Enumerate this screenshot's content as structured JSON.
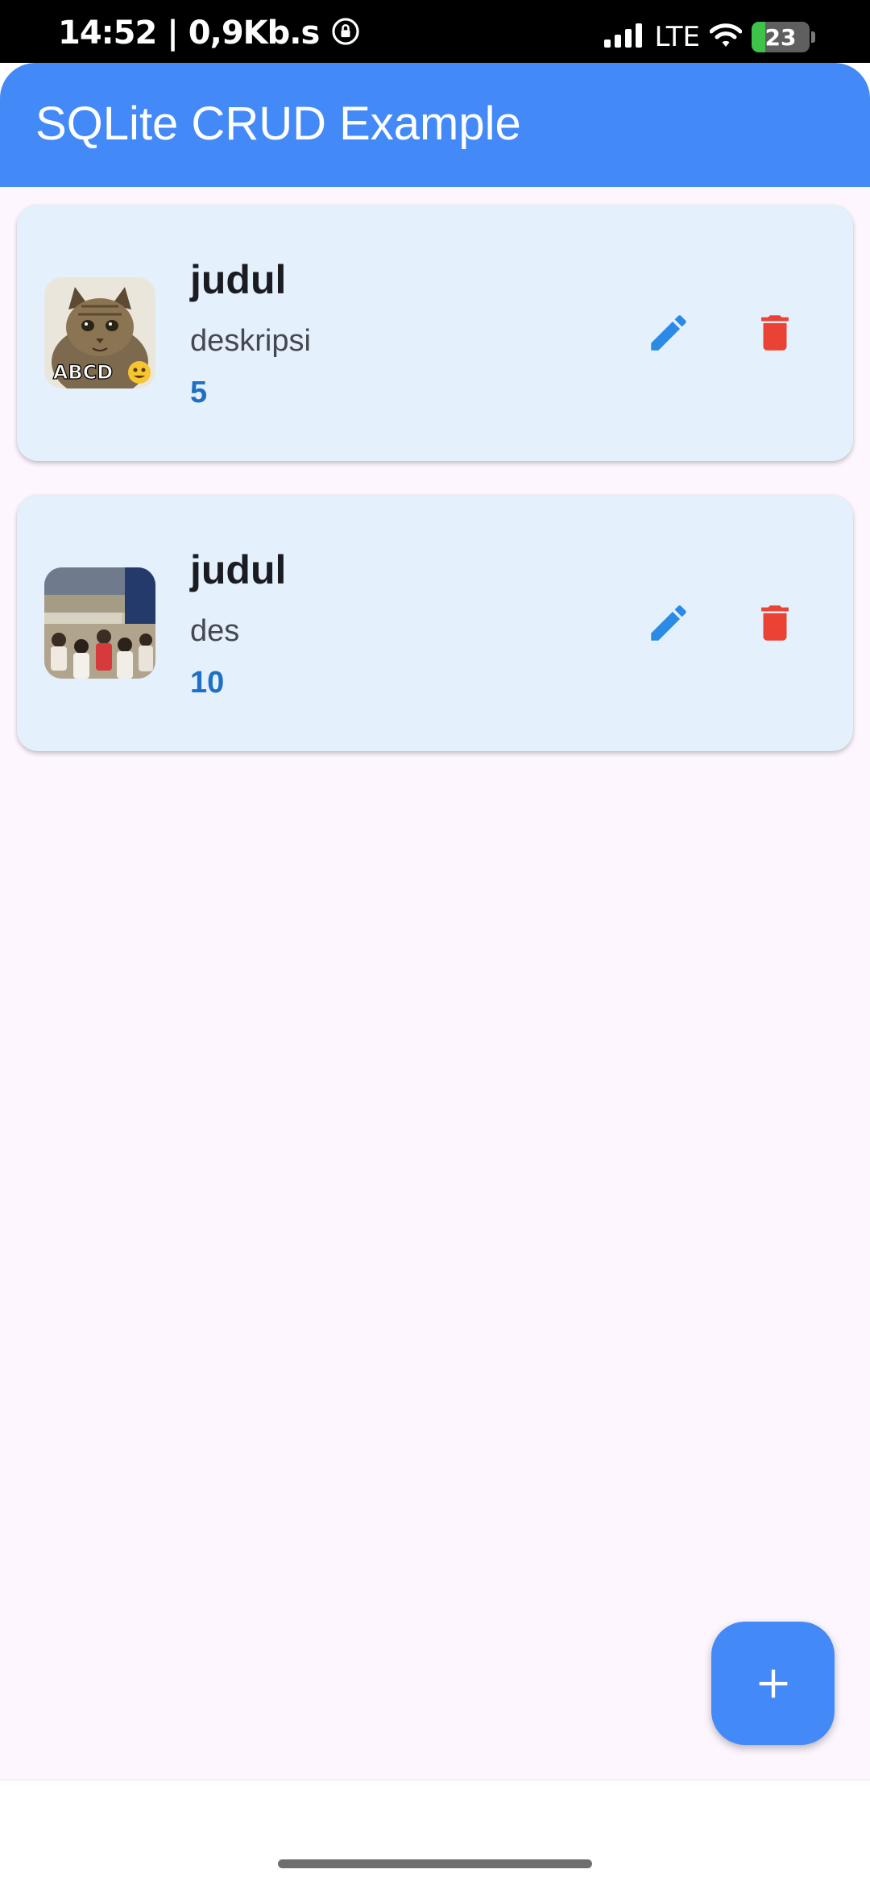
{
  "status_bar": {
    "time_text": "14:52 | 0,9Kb.s",
    "network_label": "LTE",
    "battery_level": "23",
    "battery_fraction": 0.23
  },
  "app_bar": {
    "title": "SQLite CRUD Example",
    "color": "#438af8"
  },
  "items": [
    {
      "title": "judul",
      "description": "deskripsi",
      "quantity": "5",
      "image": "cat-meme-thumbnail",
      "image_caption": "ABCD"
    },
    {
      "title": "judul",
      "description": "des",
      "quantity": "10",
      "image": "crowd-arena-thumbnail"
    }
  ],
  "icons": {
    "edit": "pencil-icon",
    "delete": "trash-icon",
    "add": "plus-icon"
  },
  "colors": {
    "edit_icon": "#2a8ae6",
    "delete_icon": "#ea4335",
    "card_background": "#e4f1fd",
    "page_background": "#fdf6fe",
    "quantity_text": "#1f6fc5"
  }
}
